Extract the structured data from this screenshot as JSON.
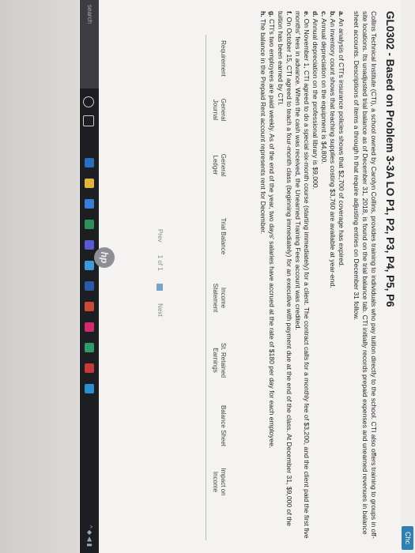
{
  "topbar": {
    "chat_label": "Chc"
  },
  "problem": {
    "title": "GL0302 - Based on Problem 3-3A LO P1, P2, P3, P4, P5, P6",
    "intro": "Collins Technical Institute (CTI), a school owned by Carolyn Collins, provides training to individuals who pay tuition directly to the school. CTI also offers training to groups in off-site locations. Its unadjusted trial balance as of December 31, 2018, is found on the trial balance tab. CTI initially records prepaid expenses and unearned revenues in balance sheet accounts. Descriptions of items a through h that require adjusting entries on December 31 follow.",
    "items": [
      {
        "letter": "a.",
        "text": "An analysis of CTI's insurance policies shows that $2,700 of coverage has expired."
      },
      {
        "letter": "b.",
        "text": "An inventory count shows that teaching supplies costing $3,760 are available at year-end."
      },
      {
        "letter": "c.",
        "text": "Annual depreciation on the equipment is $4,800."
      },
      {
        "letter": "d.",
        "text": "Annual depreciation on the professional library is $9,000."
      },
      {
        "letter": "e.",
        "text": "On November 1, CTI agreed to do a special six-month course (starting immediately) for a client. The contract calls for a monthly fee of $3,200, and the client paid the first five months' fees in advance. When the cash was received, the Unearned Training Fees account was credited."
      },
      {
        "letter": "f.",
        "text": "On October 15, CTI agreed to teach a four-month class (beginning immediately) for an executive with payment due at the end of the class. At December 31, $9,000 of the tuition has been earned by CTI."
      },
      {
        "letter": "g.",
        "text": "CTI's two employees are paid weekly. As of the end of the year, two days' salaries have accrued at the rate of $180 per day for each employee."
      },
      {
        "letter": "h.",
        "text": "The balance in the Prepaid Rent account represents rent for December."
      }
    ]
  },
  "tabs": [
    {
      "line1": "Requirement",
      "line2": ""
    },
    {
      "line1": "General",
      "line2": "Journal"
    },
    {
      "line1": "General",
      "line2": "Ledger"
    },
    {
      "line1": "Trial Balance",
      "line2": ""
    },
    {
      "line1": "Income",
      "line2": "Statement"
    },
    {
      "line1": "St. Retained",
      "line2": "Earnings"
    },
    {
      "line1": "Balance Sheet",
      "line2": ""
    },
    {
      "line1": "Impact on",
      "line2": "Income"
    }
  ],
  "pager": {
    "prev": "Prev",
    "page": "1 of 1",
    "next": "Next"
  },
  "taskbar": {
    "search": "search"
  },
  "bezel": {
    "logo": "hp"
  },
  "colors": {
    "screen_bg": "#f4f3f1",
    "chat_button": "#2f7fb0",
    "taskbar": "#1d1e22"
  }
}
